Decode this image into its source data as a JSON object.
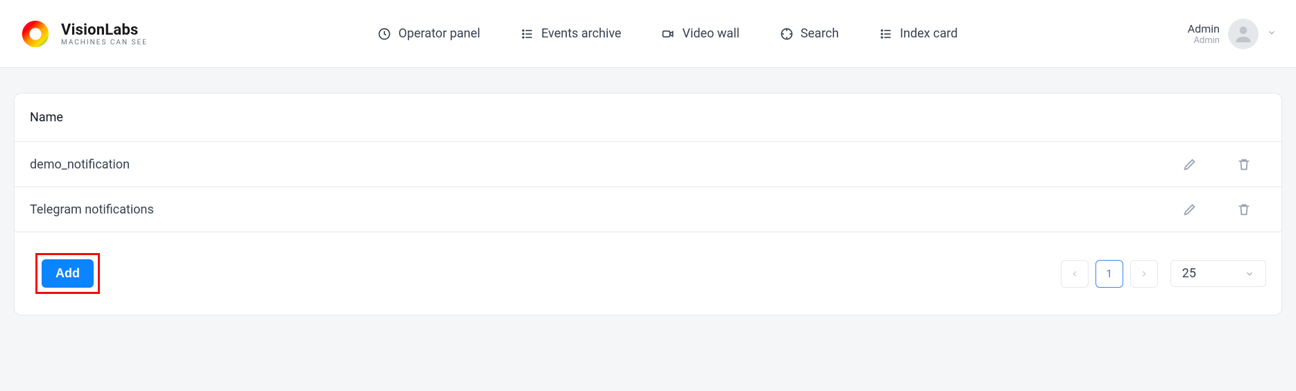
{
  "brand": {
    "title": "VisionLabs",
    "tagline": "MACHINES CAN SEE"
  },
  "nav": {
    "operator_panel": "Operator panel",
    "events_archive": "Events archive",
    "video_wall": "Video wall",
    "search": "Search",
    "index_card": "Index card"
  },
  "user": {
    "name": "Admin",
    "role": "Admin"
  },
  "table": {
    "header_name": "Name",
    "rows": [
      {
        "name": "demo_notification"
      },
      {
        "name": "Telegram notifications"
      }
    ]
  },
  "actions": {
    "add": "Add"
  },
  "pagination": {
    "current": "1",
    "page_size": "25"
  }
}
